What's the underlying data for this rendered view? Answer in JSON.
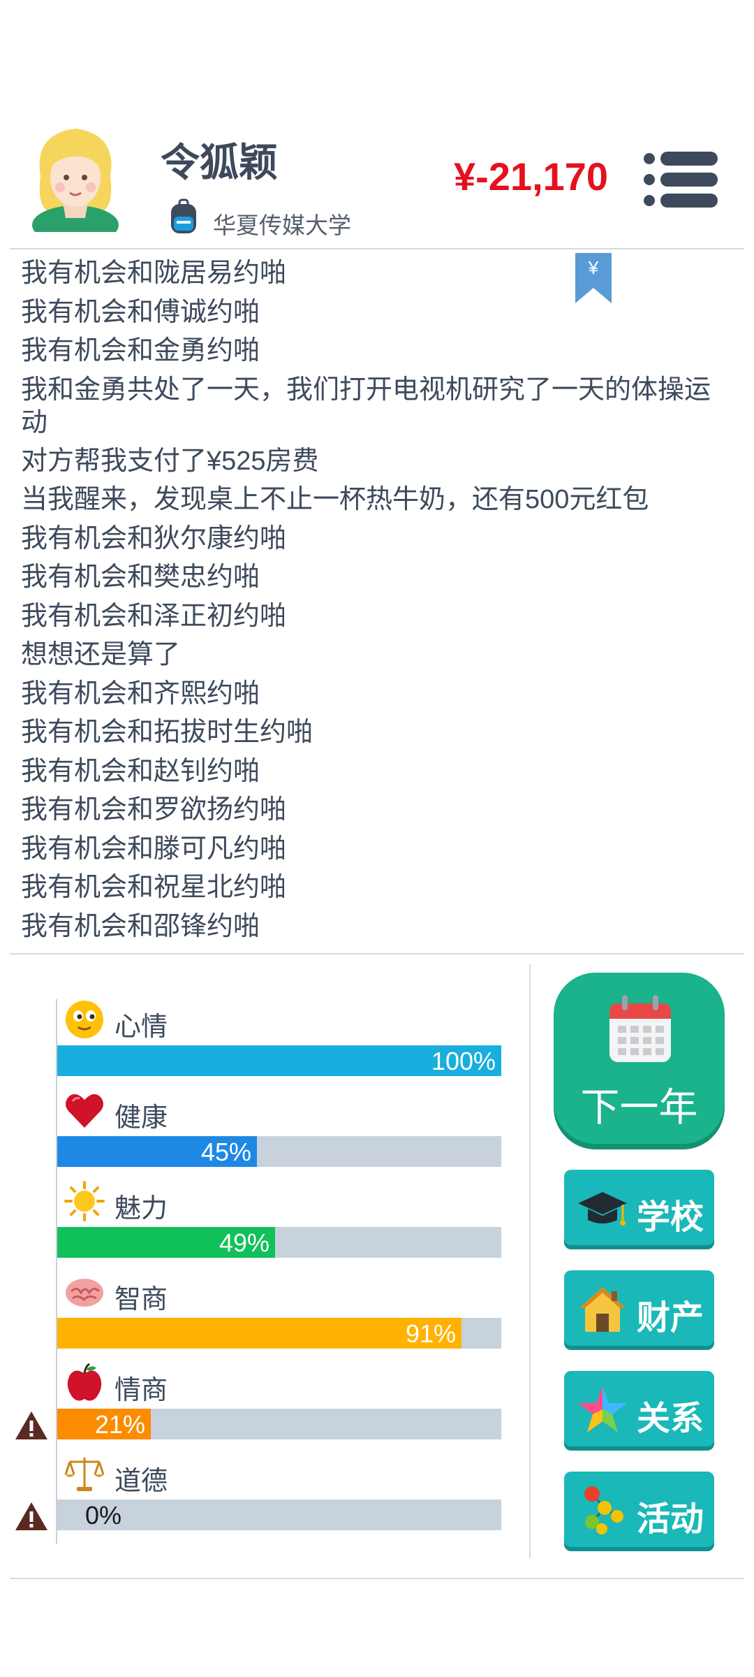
{
  "profile": {
    "name": "令狐颖",
    "school": "华夏传媒大学",
    "money": "¥-21,170"
  },
  "log": [
    "我有机会和陇居易约啪",
    "我有机会和傅诚约啪",
    "我有机会和金勇约啪",
    "我和金勇共处了一天，我们打开电视机研究了一天的体操运动",
    "对方帮我支付了¥525房费",
    "当我醒来，发现桌上不止一杯热牛奶，还有500元红包",
    "我有机会和狄尔康约啪",
    "我有机会和樊忠约啪",
    "我有机会和泽正初约啪",
    "想想还是算了",
    "我有机会和齐熙约啪",
    "我有机会和拓拔时生约啪",
    "我有机会和赵钊约啪",
    "我有机会和罗欲扬约啪",
    "我有机会和滕可凡约啪",
    "我有机会和祝星北约啪",
    "我有机会和邵锋约啪"
  ],
  "bookmark": {
    "symbol": "¥"
  },
  "stats": [
    {
      "label": "心情",
      "value": 100,
      "text": "100%",
      "color": "#1aaede",
      "icon": "smiley-face-icon",
      "warning": false
    },
    {
      "label": "健康",
      "value": 45,
      "text": "45%",
      "color": "#1e88e5",
      "icon": "heart-icon",
      "warning": false
    },
    {
      "label": "魅力",
      "value": 49,
      "text": "49%",
      "color": "#10c15a",
      "icon": "sun-icon",
      "warning": false
    },
    {
      "label": "智商",
      "value": 91,
      "text": "91%",
      "color": "#ffb300",
      "icon": "brain-icon",
      "warning": false
    },
    {
      "label": "情商",
      "value": 21,
      "text": "21%",
      "color": "#fb8c00",
      "icon": "apple-icon",
      "warning": true
    },
    {
      "label": "道德",
      "value": 0,
      "text": "0%",
      "color": "#c8d2dc",
      "icon": "scales-icon",
      "warning": true
    }
  ],
  "actions": {
    "next_year": "下一年",
    "school": "学校",
    "property": "财产",
    "relations": "关系",
    "activities": "活动"
  }
}
